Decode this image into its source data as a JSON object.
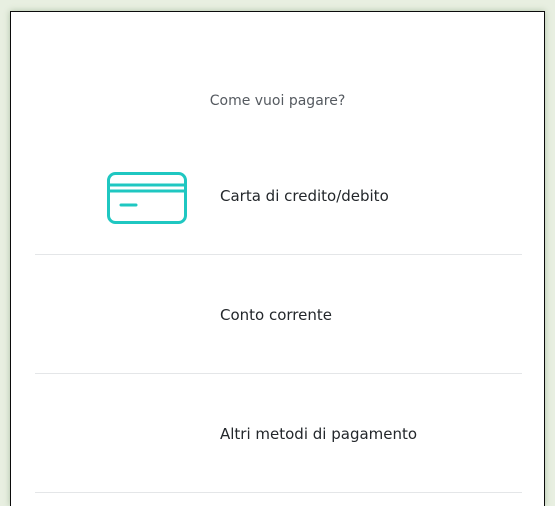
{
  "prompt": "Come vuoi pagare?",
  "accent_color": "#1fc7c1",
  "options": [
    {
      "label": "Carta di credito/debito",
      "icon": "credit-card-icon"
    },
    {
      "label": "Conto corrente"
    },
    {
      "label": "Altri metodi di pagamento"
    }
  ]
}
